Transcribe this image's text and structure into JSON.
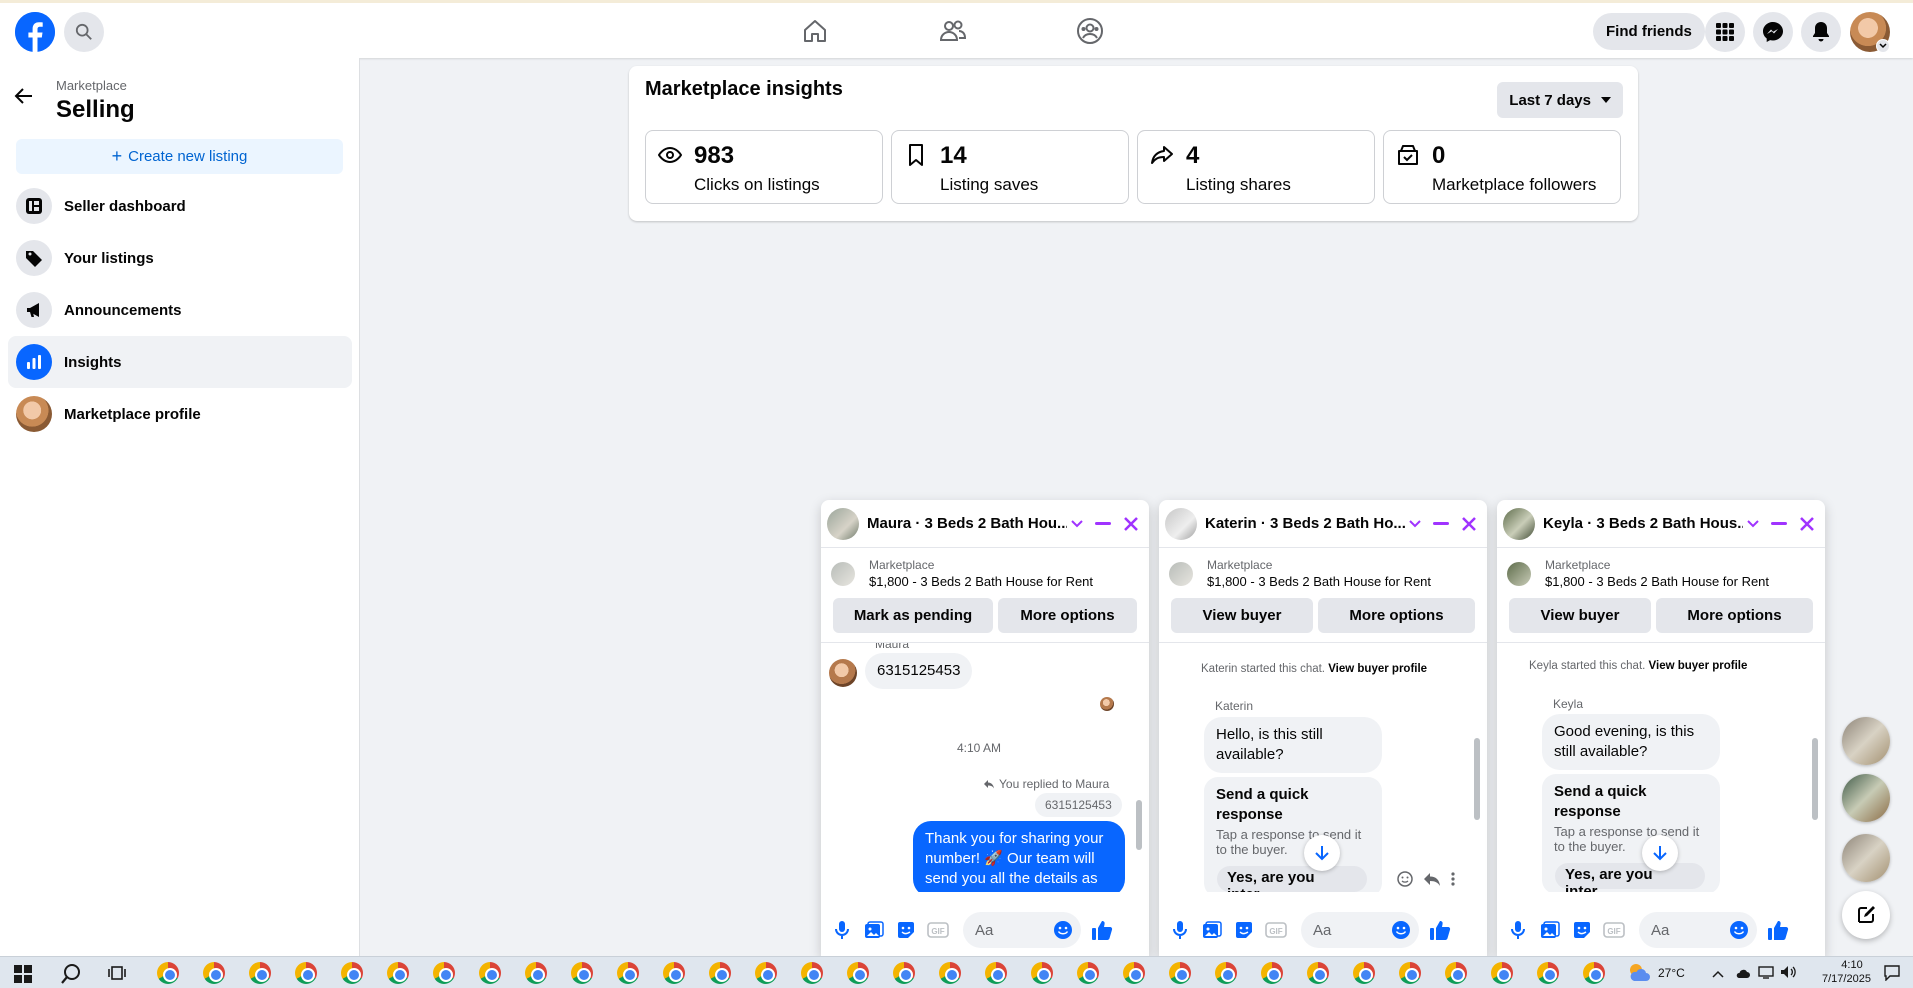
{
  "topbar": {
    "find_friends": "Find friends"
  },
  "sidebar": {
    "crumb": "Marketplace",
    "title": "Selling",
    "create_label": "Create new listing",
    "items": [
      {
        "label": "Seller dashboard",
        "icon": "dashboard-icon"
      },
      {
        "label": "Your listings",
        "icon": "tag-icon"
      },
      {
        "label": "Announcements",
        "icon": "megaphone-icon"
      },
      {
        "label": "Insights",
        "icon": "bar-chart-icon",
        "active": true
      },
      {
        "label": "Marketplace profile",
        "icon": "avatar"
      }
    ]
  },
  "insights": {
    "title": "Marketplace insights",
    "range": "Last 7 days",
    "stats": [
      {
        "value": "983",
        "label": "Clicks on listings",
        "icon": "eye-icon"
      },
      {
        "value": "14",
        "label": "Listing saves",
        "icon": "bookmark-icon"
      },
      {
        "value": "4",
        "label": "Listing shares",
        "icon": "share-icon"
      },
      {
        "value": "0",
        "label": "Marketplace followers",
        "icon": "shop-icon"
      }
    ]
  },
  "chats": [
    {
      "name": "Maura · 3 Beds 2 Bath Hou...",
      "mp_label": "Marketplace",
      "mp_title": "$1,800 - 3 Beds 2 Bath House for Rent",
      "btn1": "Mark as pending",
      "btn2": "More options",
      "sender_top": "Maura",
      "msg_phone": "6315125453",
      "time": "4:10 AM",
      "replied": "You replied to Maura",
      "quoted": "6315125453",
      "out_msg": "Thank you for sharing your number! 🚀 Our team will send you all the details as",
      "input_placeholder": "Aa"
    },
    {
      "name": "Katerin · 3 Beds 2 Bath Ho...",
      "mp_label": "Marketplace",
      "mp_title": "$1,800 - 3 Beds 2 Bath House for Rent",
      "btn1": "View buyer",
      "btn2": "More options",
      "started_pre": "Katerin started this chat.",
      "started_link": "View buyer profile",
      "sender": "Katerin",
      "msg": "Hello, is this still available?",
      "quick_title": "Send a quick response",
      "quick_sub": "Tap a response to send it to the buyer.",
      "quick_opt": "Yes, are you inter...",
      "input_placeholder": "Aa"
    },
    {
      "name": "Keyla · 3 Beds 2 Bath Hous...",
      "mp_label": "Marketplace",
      "mp_title": "$1,800 - 3 Beds 2 Bath House for Rent",
      "btn1": "View buyer",
      "btn2": "More options",
      "started_pre": "Keyla started this chat.",
      "started_link": "View buyer profile",
      "sender": "Keyla",
      "msg": "Good evening, is this still available?",
      "quick_title": "Send a quick response",
      "quick_sub": "Tap a response to send it to the buyer.",
      "quick_opt": "Yes, are you inter...",
      "input_placeholder": "Aa"
    }
  ],
  "taskbar": {
    "weather": "27°C",
    "time": "4:10",
    "date": "7/17/2025"
  },
  "colors": {
    "accent": "#0866ff",
    "chat_accent": "#a033ff",
    "bg": "#f0f2f5"
  }
}
